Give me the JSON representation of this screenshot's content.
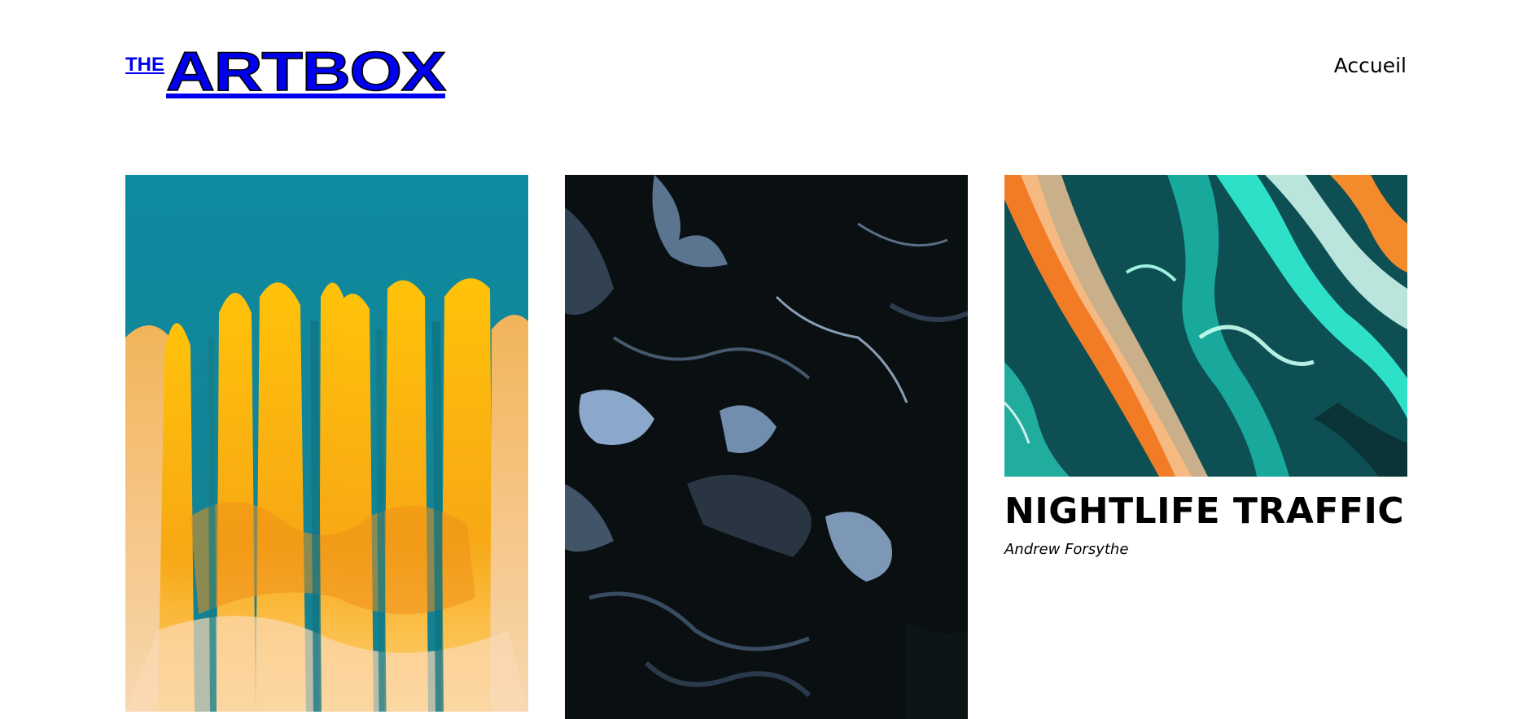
{
  "header": {
    "logo": {
      "small_text": "THE",
      "main_text": "ARTBOX"
    },
    "nav": {
      "home_label": "Accueil"
    }
  },
  "gallery": {
    "items": [
      {
        "image": "yellow-teal-paint-drip-artwork"
      },
      {
        "image": "black-blue-marble-fluid-artwork"
      },
      {
        "image": "teal-orange-fluid-swirl-artwork",
        "title": "NIGHTLIFE TRAFFIC",
        "author": "Andrew Forsythe"
      }
    ]
  },
  "colors": {
    "background": "#ffffff",
    "text": "#000000",
    "teal": "#148ea5",
    "yellow": "#fbb700",
    "dark": "#0b1012",
    "steel_blue": "#7d9cc0",
    "orange": "#f0802a",
    "aqua": "#21d6c3"
  }
}
